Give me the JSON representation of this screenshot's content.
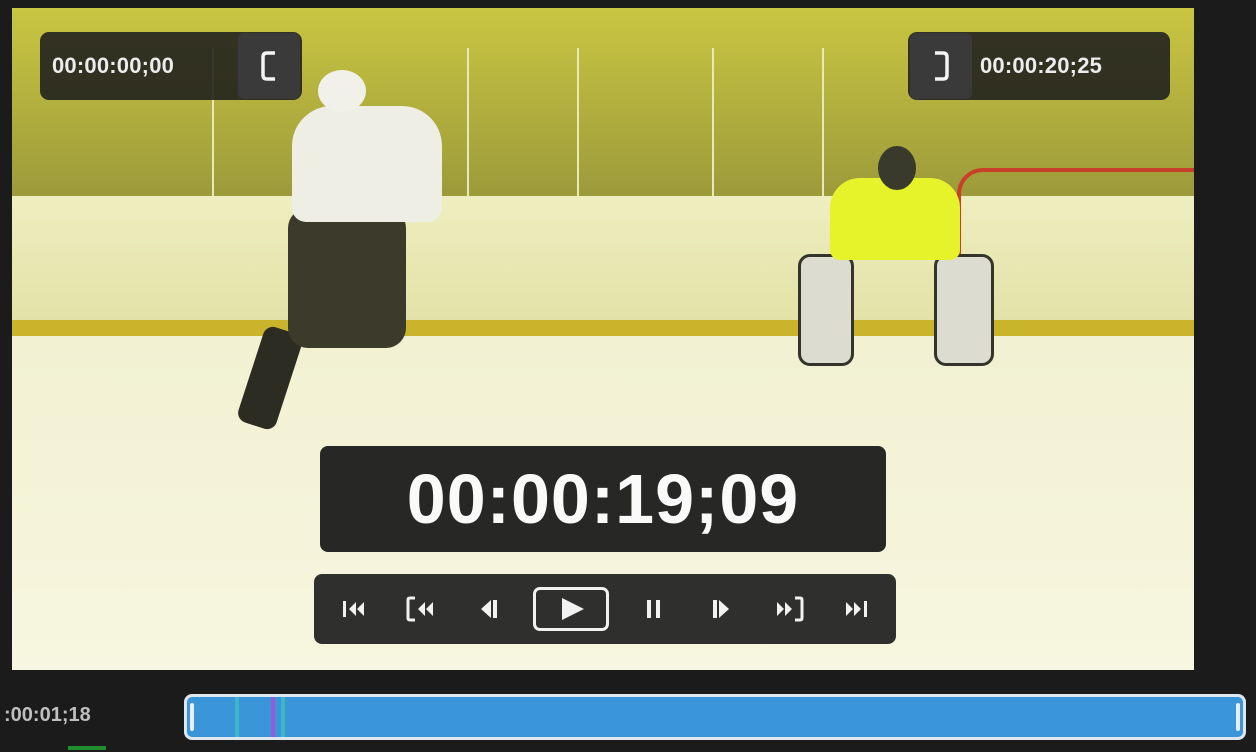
{
  "viewer": {
    "in_point": {
      "timecode": "00:00:00;00",
      "icon": "mark-in-bracket-icon"
    },
    "out_point": {
      "timecode": "00:00:20;25",
      "icon": "mark-out-bracket-icon"
    },
    "current_timecode": "00:00:19;09"
  },
  "transport": {
    "buttons": [
      {
        "name": "go-to-start",
        "icon": "skip-to-start-icon"
      },
      {
        "name": "go-to-in-point",
        "icon": "go-to-in-icon"
      },
      {
        "name": "step-back",
        "icon": "step-back-icon"
      },
      {
        "name": "play",
        "icon": "play-in-to-out-icon"
      },
      {
        "name": "pause",
        "icon": "pause-icon"
      },
      {
        "name": "step-forward",
        "icon": "step-forward-icon"
      },
      {
        "name": "go-to-out-point",
        "icon": "go-to-out-icon"
      },
      {
        "name": "go-to-end",
        "icon": "skip-to-end-icon"
      }
    ]
  },
  "timeline": {
    "timecode": ":00:01;18",
    "track_color": "#3a96d8",
    "marker_colors": [
      "#9b59d8",
      "#3ec6c0"
    ]
  },
  "colors": {
    "overlay_bg": "#1e1e1e",
    "frame_tint": "#d8d44a"
  }
}
